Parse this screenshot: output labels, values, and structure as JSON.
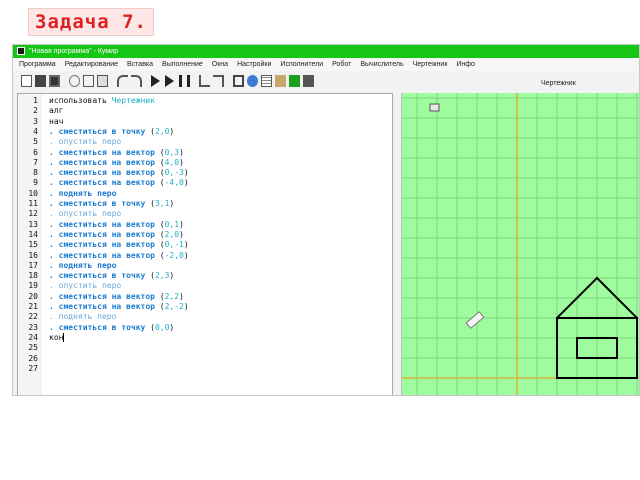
{
  "task_title": "Задача 7.",
  "window": {
    "title": "\"Новая программа\" - Кумир",
    "menu": [
      "Программа",
      "Редактирование",
      "Вставка",
      "Выполнение",
      "Окна",
      "Настройки",
      "Исполнители",
      "Робот",
      "Вычислитель",
      "Чертежник",
      "Инфо"
    ]
  },
  "drawer_panel_title": "Чертежник",
  "code_lines": [
    {
      "n": "1",
      "parts": [
        {
          "t": "использовать ",
          "c": "kw"
        },
        {
          "t": "Чертежник",
          "c": "arg"
        }
      ]
    },
    {
      "n": "2",
      "parts": [
        {
          "t": "алг",
          "c": "kw"
        }
      ]
    },
    {
      "n": "3",
      "parts": [
        {
          "t": "нач",
          "c": "kw"
        }
      ]
    },
    {
      "n": "4",
      "parts": [
        {
          "t": ". сместиться в точку",
          "c": "cmd"
        },
        {
          "t": " (",
          "c": "pnc"
        },
        {
          "t": "2,0",
          "c": "arg"
        },
        {
          "t": ")",
          "c": "pnc"
        }
      ]
    },
    {
      "n": "5",
      "parts": [
        {
          "t": ". опустить перо",
          "c": "cmd-light"
        }
      ]
    },
    {
      "n": "6",
      "parts": [
        {
          "t": ". сместиться на вектор",
          "c": "cmd"
        },
        {
          "t": " (",
          "c": "pnc"
        },
        {
          "t": "0,3",
          "c": "arg"
        },
        {
          "t": ")",
          "c": "pnc"
        }
      ]
    },
    {
      "n": "7",
      "parts": [
        {
          "t": ". сместиться на вектор",
          "c": "cmd"
        },
        {
          "t": " (",
          "c": "pnc"
        },
        {
          "t": "4,0",
          "c": "arg"
        },
        {
          "t": ")",
          "c": "pnc"
        }
      ]
    },
    {
      "n": "8",
      "parts": [
        {
          "t": ". сместиться на вектор",
          "c": "cmd"
        },
        {
          "t": " (",
          "c": "pnc"
        },
        {
          "t": "0,-3",
          "c": "arg"
        },
        {
          "t": ")",
          "c": "pnc"
        }
      ]
    },
    {
      "n": "9",
      "parts": [
        {
          "t": ". сместиться на вектор",
          "c": "cmd"
        },
        {
          "t": " (",
          "c": "pnc"
        },
        {
          "t": "-4,0",
          "c": "arg"
        },
        {
          "t": ")",
          "c": "pnc"
        }
      ]
    },
    {
      "n": "10",
      "parts": [
        {
          "t": ". поднять перо",
          "c": "cmd"
        }
      ]
    },
    {
      "n": "11",
      "parts": [
        {
          "t": ". сместиться в точку",
          "c": "cmd"
        },
        {
          "t": " (",
          "c": "pnc"
        },
        {
          "t": "3,1",
          "c": "arg"
        },
        {
          "t": ")",
          "c": "pnc"
        }
      ]
    },
    {
      "n": "12",
      "parts": [
        {
          "t": ". опустить перо",
          "c": "cmd-light"
        }
      ]
    },
    {
      "n": "13",
      "parts": [
        {
          "t": ". сместиться на вектор",
          "c": "cmd"
        },
        {
          "t": " (",
          "c": "pnc"
        },
        {
          "t": "0,1",
          "c": "arg"
        },
        {
          "t": ")",
          "c": "pnc"
        }
      ]
    },
    {
      "n": "14",
      "parts": [
        {
          "t": ". сместиться на вектор",
          "c": "cmd"
        },
        {
          "t": " (",
          "c": "pnc"
        },
        {
          "t": "2,0",
          "c": "arg"
        },
        {
          "t": ")",
          "c": "pnc"
        }
      ]
    },
    {
      "n": "15",
      "parts": [
        {
          "t": ". сместиться на вектор",
          "c": "cmd"
        },
        {
          "t": " (",
          "c": "pnc"
        },
        {
          "t": "0,-1",
          "c": "arg"
        },
        {
          "t": ")",
          "c": "pnc"
        }
      ]
    },
    {
      "n": "16",
      "parts": [
        {
          "t": ". сместиться на вектор",
          "c": "cmd"
        },
        {
          "t": " (",
          "c": "pnc"
        },
        {
          "t": "-2,0",
          "c": "arg"
        },
        {
          "t": ")",
          "c": "pnc"
        }
      ]
    },
    {
      "n": "17",
      "parts": [
        {
          "t": ". поднять перо",
          "c": "cmd"
        }
      ]
    },
    {
      "n": "18",
      "parts": [
        {
          "t": ". сместиться в точку",
          "c": "cmd"
        },
        {
          "t": " (",
          "c": "pnc"
        },
        {
          "t": "2,3",
          "c": "arg"
        },
        {
          "t": ")",
          "c": "pnc"
        }
      ]
    },
    {
      "n": "19",
      "parts": [
        {
          "t": ". опустить перо",
          "c": "cmd-light"
        }
      ]
    },
    {
      "n": "20",
      "parts": [
        {
          "t": ". сместиться на вектор",
          "c": "cmd"
        },
        {
          "t": " (",
          "c": "pnc"
        },
        {
          "t": "2,2",
          "c": "arg"
        },
        {
          "t": ")",
          "c": "pnc"
        }
      ]
    },
    {
      "n": "21",
      "parts": [
        {
          "t": ". сместиться на вектор",
          "c": "cmd"
        },
        {
          "t": " (",
          "c": "pnc"
        },
        {
          "t": "2,-2",
          "c": "arg"
        },
        {
          "t": ")",
          "c": "pnc"
        }
      ]
    },
    {
      "n": "22",
      "parts": [
        {
          "t": ". поднять перо",
          "c": "cmd-light"
        }
      ]
    },
    {
      "n": "23",
      "parts": [
        {
          "t": ". сместиться в точку",
          "c": "cmd"
        },
        {
          "t": " (",
          "c": "pnc"
        },
        {
          "t": "0,0",
          "c": "arg"
        },
        {
          "t": ")",
          "c": "pnc"
        }
      ]
    },
    {
      "n": "24",
      "parts": [
        {
          "t": "кон",
          "c": "kw"
        }
      ],
      "cursor": true
    },
    {
      "n": "25",
      "parts": []
    },
    {
      "n": "26",
      "parts": []
    },
    {
      "n": "27",
      "parts": []
    }
  ],
  "drawing": {
    "grid_color": "#7fd67f",
    "background": "#9efc9e",
    "axis_color": "#d9b43a",
    "pen_color": "#000000",
    "segments": [
      [
        [
          2,
          0
        ],
        [
          2,
          3
        ]
      ],
      [
        [
          2,
          3
        ],
        [
          6,
          3
        ]
      ],
      [
        [
          6,
          3
        ],
        [
          6,
          0
        ]
      ],
      [
        [
          6,
          0
        ],
        [
          2,
          0
        ]
      ],
      [
        [
          3,
          1
        ],
        [
          3,
          2
        ]
      ],
      [
        [
          3,
          2
        ],
        [
          5,
          2
        ]
      ],
      [
        [
          5,
          2
        ],
        [
          5,
          1
        ]
      ],
      [
        [
          5,
          1
        ],
        [
          3,
          1
        ]
      ],
      [
        [
          2,
          3
        ],
        [
          4,
          5
        ]
      ],
      [
        [
          4,
          5
        ],
        [
          6,
          3
        ]
      ]
    ]
  }
}
